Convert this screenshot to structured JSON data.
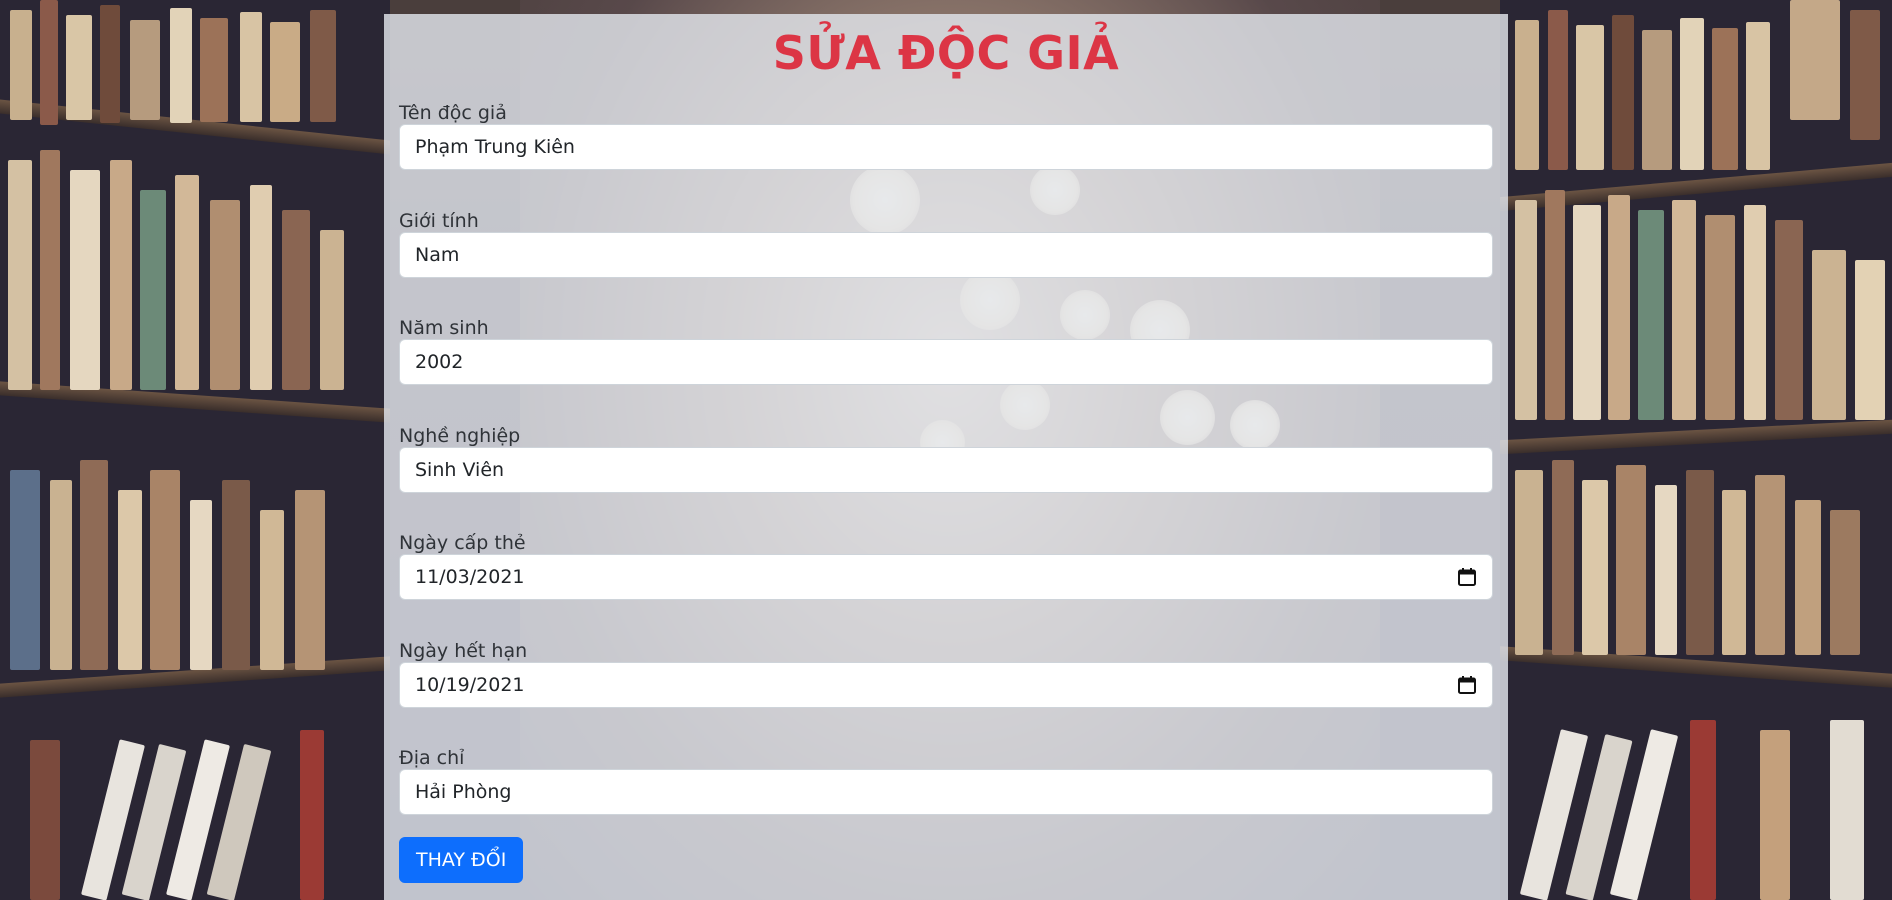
{
  "form": {
    "title": "SỬA ĐỘC GIẢ",
    "fields": [
      {
        "label": "Tên độc giả",
        "value": "Phạm Trung Kiên",
        "type": "text"
      },
      {
        "label": "Giới tính",
        "value": "Nam",
        "type": "text"
      },
      {
        "label": "Năm sinh",
        "value": "2002",
        "type": "text"
      },
      {
        "label": "Nghề nghiệp",
        "value": "Sinh Viên",
        "type": "text"
      },
      {
        "label": "Ngày cấp thẻ",
        "value": "11/03/2021",
        "type": "date"
      },
      {
        "label": "Ngày hết hạn",
        "value": "10/19/2021",
        "type": "date"
      },
      {
        "label": "Địa chỉ",
        "value": "Hải Phòng",
        "type": "text"
      }
    ],
    "submit_label": "THAY ĐỔI"
  },
  "colors": {
    "title": "#dc3545",
    "button": "#0d6efd",
    "panel": "rgba(226,229,236,0.82)"
  },
  "icons": {
    "date_picker": "calendar-icon"
  }
}
